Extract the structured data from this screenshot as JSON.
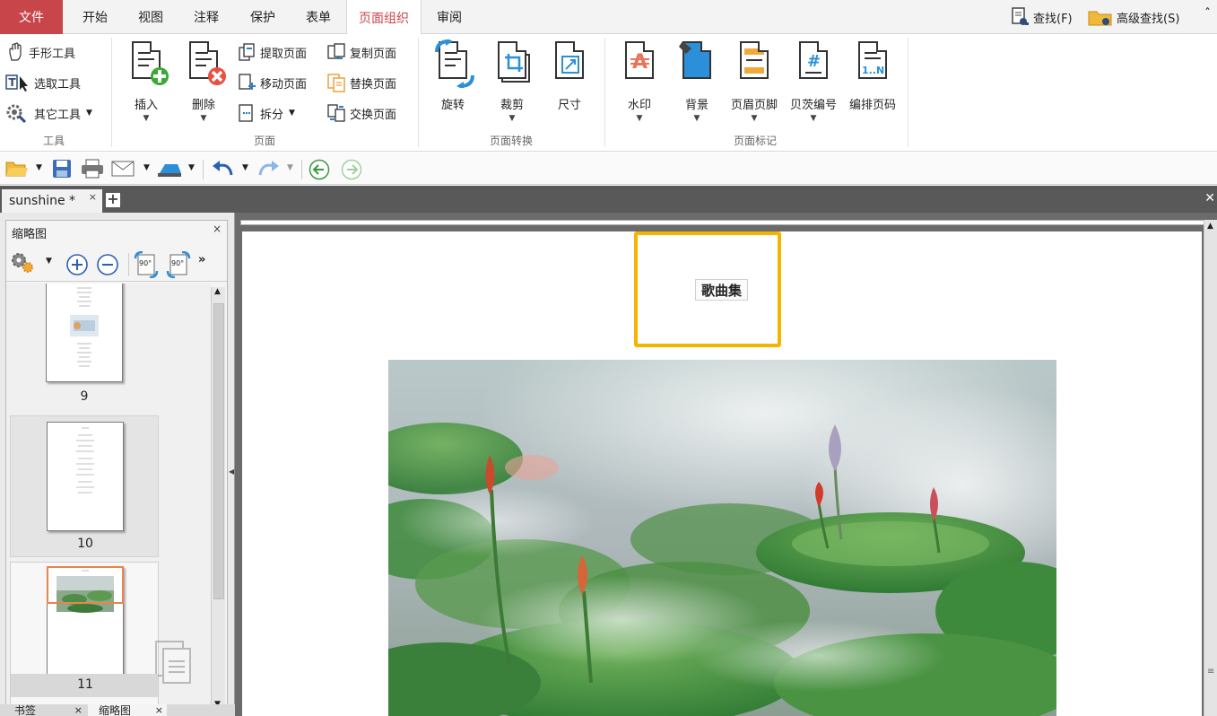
{
  "menu": {
    "file": "文件",
    "tabs": [
      "开始",
      "视图",
      "注释",
      "保护",
      "表单",
      "页面组织",
      "审阅"
    ],
    "active_tab": "页面组织",
    "find": "查找(F)",
    "advanced_find": "高级查找(S)"
  },
  "ribbon": {
    "tools_group": {
      "label": "工具",
      "hand_tool": "手形工具",
      "select_tool": "选取工具",
      "other_tools": "其它工具"
    },
    "page_group": {
      "label": "页面",
      "insert": "插入",
      "delete": "删除",
      "extract": "提取页面",
      "move": "移动页面",
      "split": "拆分",
      "copy": "复制页面",
      "replace": "替换页面",
      "swap": "交换页面"
    },
    "transform_group": {
      "label": "页面转换",
      "rotate": "旋转",
      "crop": "裁剪",
      "size": "尺寸"
    },
    "mark_group": {
      "label": "页面标记",
      "watermark": "水印",
      "background": "背景",
      "header_footer": "页眉页脚",
      "bates": "贝茨编号",
      "page_number": "编排页码"
    }
  },
  "document_tab": {
    "name": "sunshine *",
    "close": "×",
    "add": "+"
  },
  "thumbnail_panel": {
    "title": "缩略图",
    "close": "×",
    "rotate_left": "90°",
    "rotate_right": "90°",
    "pages": [
      {
        "number": "9"
      },
      {
        "number": "10"
      },
      {
        "number": "11",
        "selected": true
      }
    ],
    "bottom_tabs": [
      "书签",
      "缩略图"
    ]
  },
  "document": {
    "page_title": "歌曲集"
  },
  "colors": {
    "file_menu": "#c8464a",
    "highlight": "#f5b400",
    "tab_bar": "#595959"
  }
}
